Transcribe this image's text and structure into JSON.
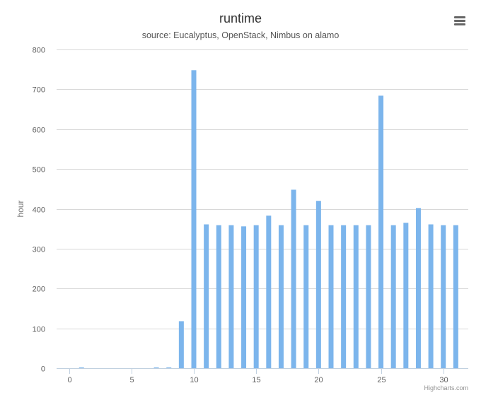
{
  "chart_data": {
    "type": "bar",
    "title": "runtime",
    "subtitle": "source: Eucalyptus, OpenStack, Nimbus on alamo",
    "ylabel": "hour",
    "xlabel": "",
    "xlim": [
      -1,
      32
    ],
    "ylim": [
      0,
      800
    ],
    "xticks": [
      0,
      5,
      10,
      15,
      20,
      25,
      30
    ],
    "yticks": [
      0,
      100,
      200,
      300,
      400,
      500,
      600,
      700,
      800
    ],
    "grid": true,
    "legend": "none",
    "colors": {
      "bar": "#7cb5ec",
      "grid": "#d8d8d8",
      "axis": "#c0d0e0"
    },
    "x": [
      0,
      1,
      2,
      3,
      4,
      5,
      6,
      7,
      8,
      9,
      10,
      11,
      12,
      13,
      14,
      15,
      16,
      17,
      18,
      19,
      20,
      21,
      22,
      23,
      24,
      25,
      26,
      27,
      28,
      29,
      30,
      31
    ],
    "values": [
      0,
      2,
      0,
      0,
      0,
      0,
      0,
      2,
      2,
      118,
      748,
      361,
      359,
      359,
      356,
      359,
      383,
      359,
      448,
      359,
      420,
      359,
      359,
      359,
      359,
      684,
      359,
      365,
      402,
      361,
      359,
      359
    ]
  },
  "menu": {
    "icon": "hamburger-menu-icon"
  },
  "credits": "Highcharts.com"
}
